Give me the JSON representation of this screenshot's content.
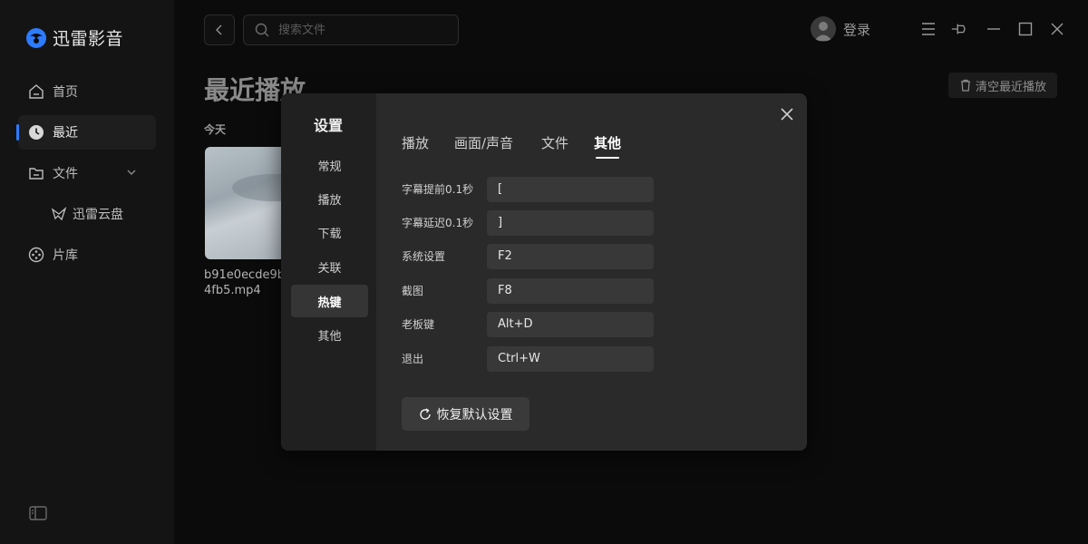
{
  "app": {
    "name": "迅雷影音"
  },
  "sidebar": {
    "items": [
      {
        "label": "首页",
        "icon": "home-icon"
      },
      {
        "label": "最近",
        "icon": "clock-icon",
        "active": true
      },
      {
        "label": "文件",
        "icon": "folder-icon"
      },
      {
        "label": "片库",
        "icon": "film-reel-icon"
      }
    ],
    "sub_items": [
      {
        "label": "迅雷云盘",
        "icon": "cloud-bird-icon"
      }
    ]
  },
  "topbar": {
    "search_placeholder": "搜索文件",
    "login_label": "登录"
  },
  "main": {
    "title": "最近播放",
    "clear_label": "清空最近播放",
    "section_label": "今天",
    "file": {
      "name_line1": "b91e0ecde9b",
      "name_line2": "4fb5.mp4"
    }
  },
  "dialog": {
    "title": "设置",
    "nav": [
      {
        "label": "常规"
      },
      {
        "label": "播放"
      },
      {
        "label": "下载"
      },
      {
        "label": "关联"
      },
      {
        "label": "热键",
        "active": true
      },
      {
        "label": "其他"
      }
    ],
    "tabs": [
      {
        "label": "播放"
      },
      {
        "label": "画面/声音"
      },
      {
        "label": "文件"
      },
      {
        "label": "其他",
        "active": true
      }
    ],
    "hotkeys": [
      {
        "label": "字幕提前0.1秒",
        "key": "["
      },
      {
        "label": "字幕延迟0.1秒",
        "key": "]"
      },
      {
        "label": "系统设置",
        "key": "F2"
      },
      {
        "label": "截图",
        "key": "F8"
      },
      {
        "label": "老板键",
        "key": "Alt+D"
      },
      {
        "label": "退出",
        "key": "Ctrl+W"
      }
    ],
    "restore_label": "恢复默认设置"
  },
  "colors": {
    "accent": "#2d7bff",
    "background": "#0b0b0b",
    "dialog": "#2a2a2a"
  }
}
